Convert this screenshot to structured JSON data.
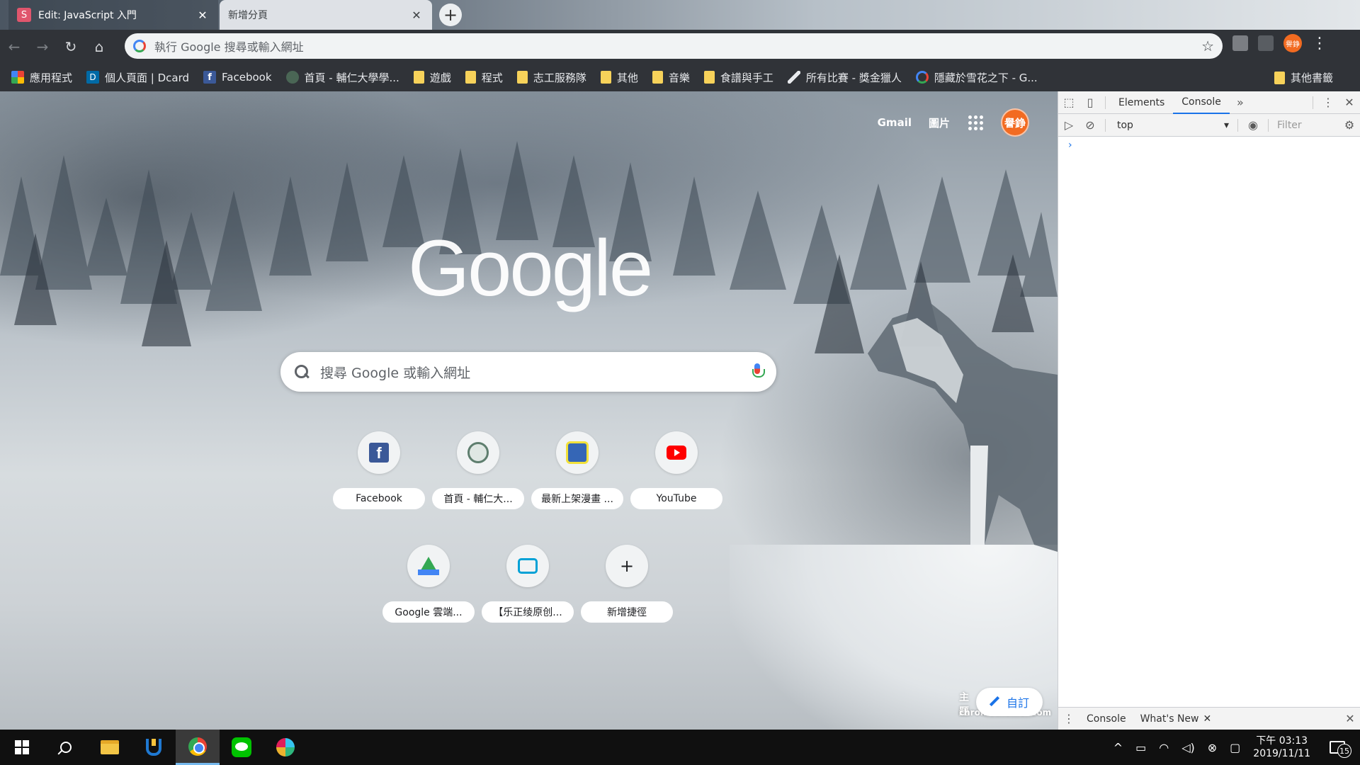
{
  "tabs": [
    {
      "favicon": "S",
      "title": "Edit: JavaScript 入門",
      "active": true
    },
    {
      "title": "新增分頁",
      "active": false
    }
  ],
  "toolbar": {
    "omnibox_placeholder": "執行 Google 搜尋或輸入網址",
    "profile_initials": "譽錚"
  },
  "bookmarks": [
    {
      "label": "應用程式",
      "icon": "apps-grid-icon"
    },
    {
      "label": "個人頁面 | Dcard",
      "icon": "dcard-icon"
    },
    {
      "label": "Facebook",
      "icon": "facebook-icon"
    },
    {
      "label": "首頁 - 輔仁大學學...",
      "icon": "seal-icon"
    },
    {
      "label": "遊戲",
      "icon": "folder-icon"
    },
    {
      "label": "程式",
      "icon": "folder-icon"
    },
    {
      "label": "志工服務隊",
      "icon": "folder-icon"
    },
    {
      "label": "其他",
      "icon": "folder-icon"
    },
    {
      "label": "音樂",
      "icon": "folder-icon"
    },
    {
      "label": "食譜與手工",
      "icon": "folder-icon"
    },
    {
      "label": "所有比賽 - 獎金獵人",
      "icon": "shoe-icon"
    },
    {
      "label": "隱藏於雪花之下 - G...",
      "icon": "google-icon"
    }
  ],
  "other_bookmarks": "其他書籤",
  "ntp": {
    "gmail": "Gmail",
    "images": "圖片",
    "avatar": "譽錚",
    "logo": "Google",
    "search_placeholder": "搜尋 Google 或輸入網址",
    "shortcuts": [
      {
        "label": "Facebook",
        "icon": "facebook-icon"
      },
      {
        "label": "首頁 - 輔仁大...",
        "icon": "seal-icon"
      },
      {
        "label": "最新上架漫畫 ...",
        "icon": "manga-icon"
      },
      {
        "label": "YouTube",
        "icon": "youtube-icon"
      },
      {
        "label": "Google 雲端...",
        "icon": "drive-icon"
      },
      {
        "label": "【乐正绫原创...",
        "icon": "bilibili-icon"
      },
      {
        "label": "新增捷徑",
        "icon": "plus-icon"
      }
    ],
    "customize": "自訂",
    "theme_by": "主題",
    "theme_source": "chromethemer.com"
  },
  "devtools": {
    "tabs": [
      "Elements",
      "Console"
    ],
    "active_tab": "Console",
    "context": "top",
    "filter_placeholder": "Filter",
    "drawer_tabs": [
      "Console",
      "What's New"
    ]
  },
  "taskbar": {
    "time": "下午 03:13",
    "date": "2019/11/11",
    "notifications": "15"
  },
  "colors": {
    "accent_blue": "#1a73e8",
    "profile_orange": "#f26b21",
    "toolbar_dark": "#303338"
  }
}
